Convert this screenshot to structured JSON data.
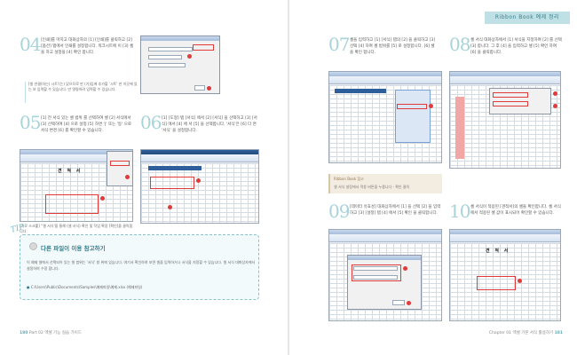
{
  "header": {
    "tab": "Ribbon Book 예제 정리"
  },
  "left_page": {
    "step04": {
      "num": "04",
      "text": "[인쇄]를 마치고 대화상자의 [1] [인쇄]를 클릭하고 [2] [옵션] 탭에서 인쇄를 설정합니다. 워크시트에 이 [3] 셀을 하고 설정을 [4] 확인 합니다.",
      "note": "[셀 연결(하는) 시트'(는) 있으므로 만 (기)입에 추가할 '시트' 만 이곳에 있는 보 입력할 수 있습니다. 만 명령하려 입력할 수 있습니다."
    },
    "step05": {
      "num": "05",
      "text": "[1] 전 서식 있는 셀 범위 를 선택하여 셀 [2] 서식에서 [3] 선택하여 [4] 으로 설정 [5] 하면 '|' 또는 '등' 으로 서식 변경 [6] 를 확인할 수 있습니다.",
      "caption": "[가로 스크롤] ''셀 서식'을 통해 (셀 서식) 확인 및 작업 확장 [확인]을 클릭합니다."
    },
    "step06": {
      "num": "06",
      "text": "[1] [도형] 탭 [서식] 에서 [2] [서식] 을 선택하고 [3] [서식] 에서 [4] 에 서 [5] 을 선택합니다. '서식'은 [6] 다 면 '서식' 을 설정합니다."
    },
    "doc_title": "견 적 서",
    "tip": {
      "label": "TIP",
      "heading": "다른 파일이 이용 참고하기",
      "body": "이 예제 셀에서 선택되어 있는 셀 범위는 '서식' 창 위에 있습니다. 여기서 확인하여 보면 셀을 입력하거나 서식을 지정할 수 있습니다. 셀 서식 대화상자에서 설정하여 수정 합니다.",
      "path": "C:\\Users\\Public\\Documents\\Samples\\예제파일\\예제.xlsx (예제파일)"
    },
    "footer": {
      "page": "180",
      "section": "Part 02 엑셀 기능 실습 가이드"
    }
  },
  "right_page": {
    "step07": {
      "num": "07",
      "text": "셀을 입력하고 [1] [서식] 탭의 [2] 을 클릭하고 [3] 선택 [4] 하여 셀 범위를 [5] 로 설정합니다. [6] 셀 을 확인 합니다."
    },
    "step08": {
      "num": "08",
      "text": "셀 서식 대화상자에서 [1] 서식을 지정하여 [2] 를 선택 [3] 합니다. 그 후 [4] 을 입력하고 셀 [5] 확인 하여 [6] 을 클릭합니다."
    },
    "memo": {
      "title": "Ribbon Book 참고",
      "body": "셀 서식 설정에서 적용 버튼을 누릅니다 - 확인 클릭"
    },
    "step09": {
      "num": "09",
      "text": "[데이터 유효성] 대화상자에서 [1] 을 선택 [2] 을 입력하고 [3] [설정] 탭 [4] 에서 [5] 확인 을 클릭합니다."
    },
    "step10": {
      "num": "10",
      "text": "셀 서식이 적용된 [견적서]의 셀을 확인합니다. 셀 서식에서 적용된 셀 값이 표시되어 확인할 수 있습니다."
    },
    "doc_title": "견 적 서",
    "footer": {
      "chapter": "Chapter 01 엑셀 기본 서식 활용하기",
      "page": "181"
    }
  }
}
